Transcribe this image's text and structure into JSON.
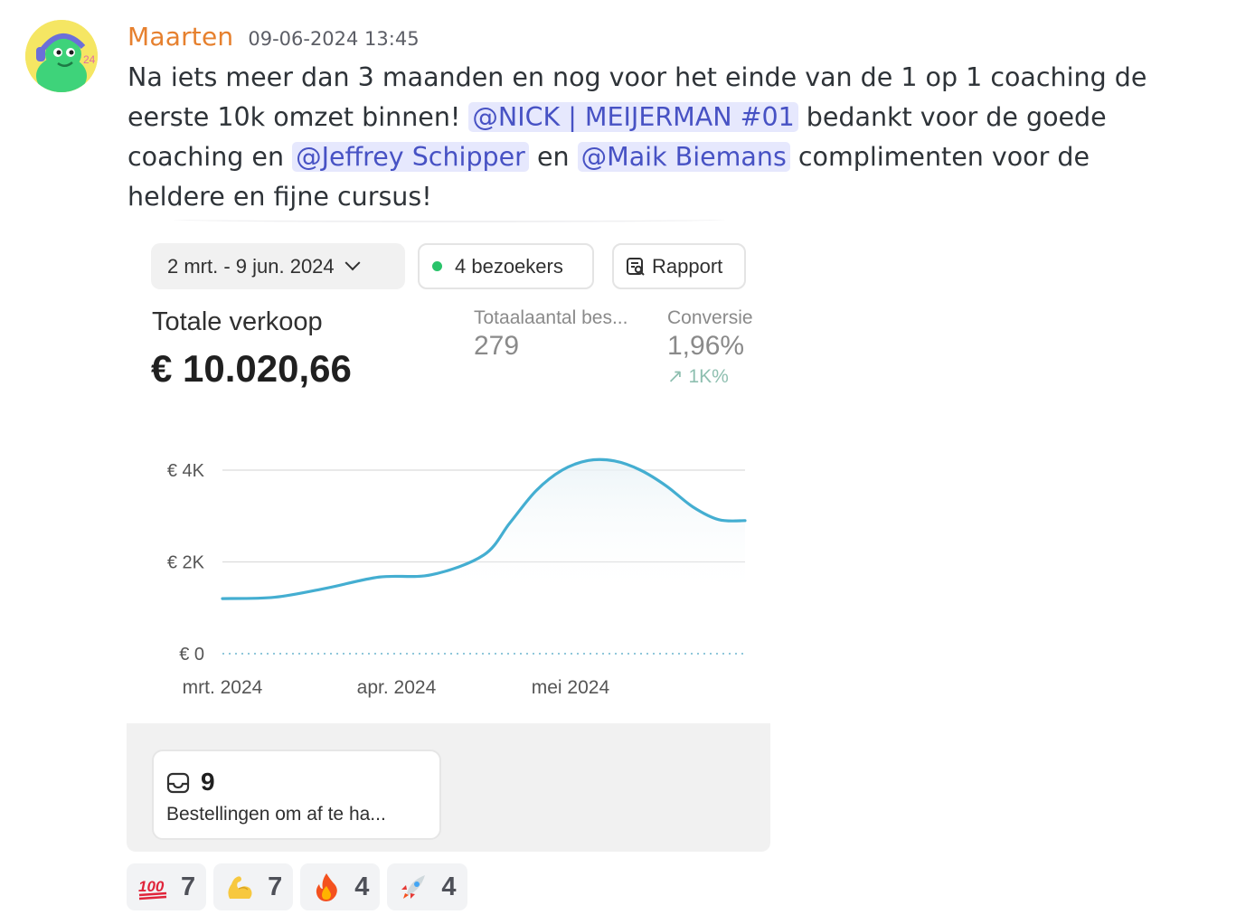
{
  "message": {
    "username": "Maarten",
    "timestamp": "09-06-2024 13:45",
    "text_1": "Na iets meer dan 3 maanden en nog voor het einde van de 1 op 1 coaching de eerste 10k omzet binnen! ",
    "mention_1": "@NICK | MEIJERMAN #01",
    "text_2": " bedankt voor de goede coaching en ",
    "mention_2": "@Jeffrey Schipper",
    "text_3": " en ",
    "mention_3": "@Maik Biemans",
    "text_4": " complimenten voor de heldere en fijne cursus!",
    "colors": {
      "username": "#e6802e",
      "mention_bg": "#e6e8fd",
      "mention_text": "#4752c4"
    }
  },
  "embed": {
    "date_range": "2 mrt. - 9 jun. 2024",
    "visitors": "4 bezoekers",
    "report": "Rapport",
    "total_sales_label": "Totale verkoop",
    "total_sales_value": "€ 10.020,66",
    "metrics": [
      {
        "label": "Totaalaantal bes...",
        "value": "279"
      },
      {
        "label": "Conversie",
        "value": "1,96%",
        "delta": "1K%"
      }
    ],
    "orders": {
      "count": "9",
      "label": "Bestellingen om af te ha..."
    }
  },
  "chart_data": {
    "type": "line",
    "y_ticks": [
      "€ 4K",
      "€ 2K",
      "€ 0"
    ],
    "x_ticks": [
      "mrt. 2024",
      "apr. 2024",
      "mei 2024"
    ],
    "ylim": [
      0,
      4000
    ],
    "grid": true,
    "series": [
      {
        "x": [
          0,
          0.1,
          0.2,
          0.3,
          0.4,
          0.5,
          0.55,
          0.6,
          0.65,
          0.7,
          0.75,
          0.8,
          0.85,
          0.9,
          0.95,
          1.0
        ],
        "values": [
          1200,
          1230,
          1430,
          1670,
          1720,
          2150,
          2850,
          3550,
          4000,
          4210,
          4200,
          4000,
          3650,
          3200,
          2920,
          2900
        ]
      }
    ],
    "colors": {
      "line": "#44aed1",
      "baseline": "#8fc7da"
    }
  },
  "reactions": [
    {
      "emoji": "hundred-points-icon",
      "count": "7"
    },
    {
      "emoji": "flexed-biceps-icon",
      "count": "7"
    },
    {
      "emoji": "fire-icon",
      "count": "4"
    },
    {
      "emoji": "rocket-icon",
      "count": "4"
    }
  ]
}
